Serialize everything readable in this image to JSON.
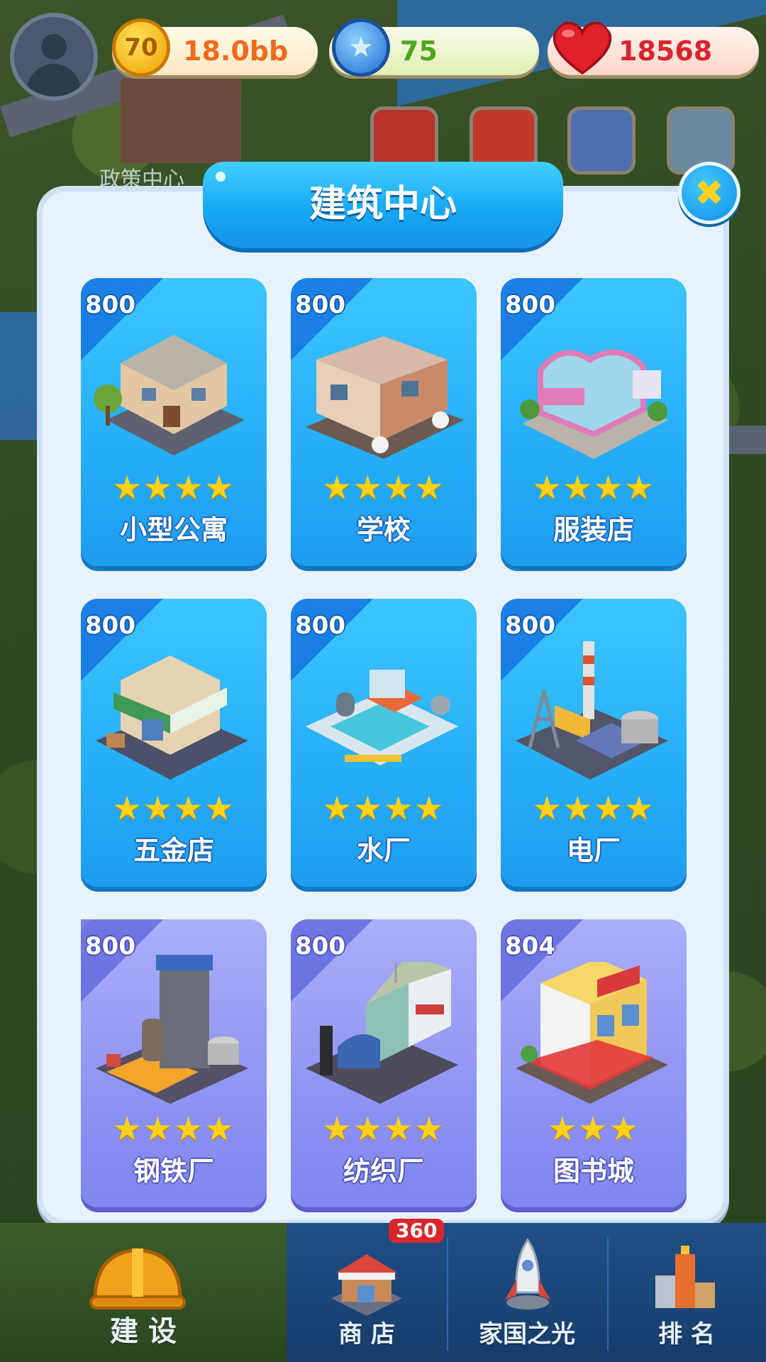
{
  "status": {
    "coins": "18.0bb",
    "coin_icon": "70",
    "stars": "75",
    "hearts": "18568"
  },
  "background": {
    "label": "政策中心"
  },
  "feature_buttons": [
    "70-event-icon",
    "handshake-icon",
    "drink-can-icon",
    "pagoda-icon"
  ],
  "panel": {
    "title": "建筑中心"
  },
  "cards": [
    {
      "price": "800",
      "stars": "★★★★",
      "name": "小型公寓",
      "style": "blue"
    },
    {
      "price": "800",
      "stars": "★★★★",
      "name": "学校",
      "style": "blue"
    },
    {
      "price": "800",
      "stars": "★★★★",
      "name": "服装店",
      "style": "blue"
    },
    {
      "price": "800",
      "stars": "★★★★",
      "name": "五金店",
      "style": "blue"
    },
    {
      "price": "800",
      "stars": "★★★★",
      "name": "水厂",
      "style": "blue"
    },
    {
      "price": "800",
      "stars": "★★★★",
      "name": "电厂",
      "style": "blue"
    },
    {
      "price": "800",
      "stars": "★★★★",
      "name": "钢铁厂",
      "style": "purple"
    },
    {
      "price": "800",
      "stars": "★★★★",
      "name": "纺织厂",
      "style": "purple"
    },
    {
      "price": "804",
      "stars": "★★★",
      "name": "图书城",
      "style": "purple"
    }
  ],
  "bottom_nav": {
    "badge": "360",
    "items": [
      {
        "label": "建 设"
      },
      {
        "label": "商 店"
      },
      {
        "label": "家国之光"
      },
      {
        "label": "排 名"
      }
    ]
  },
  "colors": {
    "card_blue": "#27b0f8",
    "card_purple": "#8e94f3",
    "panel_bg": "#e8f2fc",
    "title_bar": "#16a6f2",
    "star_gold": "#ffd21a"
  }
}
